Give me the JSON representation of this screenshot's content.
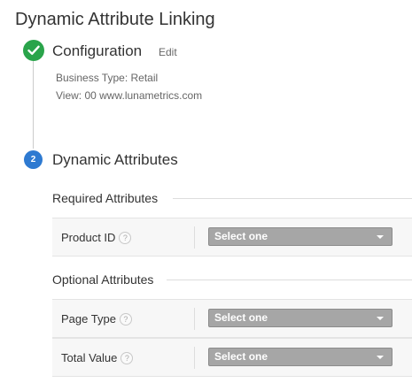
{
  "page": {
    "title": "Dynamic Attribute Linking"
  },
  "step1": {
    "title": "Configuration",
    "edit_label": "Edit",
    "status_icon": "check-icon",
    "summary": [
      "Business Type: Retail",
      "View: 00 www.lunametrics.com"
    ]
  },
  "step2": {
    "number": "2",
    "title": "Dynamic Attributes",
    "required": {
      "heading": "Required Attributes",
      "rows": [
        {
          "label": "Product ID",
          "help": "?",
          "select": "Select one"
        }
      ]
    },
    "optional": {
      "heading": "Optional Attributes",
      "rows": [
        {
          "label": "Page Type",
          "help": "?",
          "select": "Select one"
        },
        {
          "label": "Total Value",
          "help": "?",
          "select": "Select one"
        }
      ]
    }
  },
  "colors": {
    "complete_green": "#2aa44b",
    "active_blue": "#2e7ad1",
    "select_gray": "#a6a6a6"
  }
}
